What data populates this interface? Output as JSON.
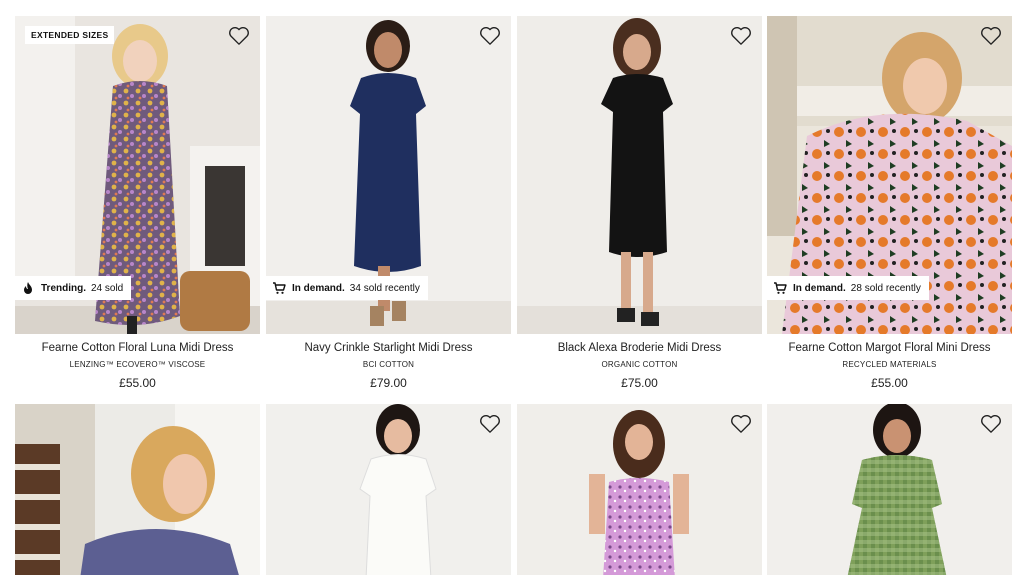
{
  "products": [
    {
      "name": "Fearne Cotton Floral Luna Midi Dress",
      "fabric": "LENZING™ ECOVERO™ VISCOSE",
      "price": "£55.00",
      "top_tag": "EXTENDED SIZES",
      "badge": {
        "icon": "flame-icon",
        "strong": "Trending.",
        "text": "24 sold"
      }
    },
    {
      "name": "Navy Crinkle Starlight Midi Dress",
      "fabric": "BCI COTTON",
      "price": "£79.00",
      "badge": {
        "icon": "cart-icon",
        "strong": "In demand.",
        "text": "34 sold recently"
      }
    },
    {
      "name": "Black Alexa Broderie Midi Dress",
      "fabric": "ORGANIC COTTON",
      "price": "£75.00"
    },
    {
      "name": "Fearne Cotton Margot Floral Mini Dress",
      "fabric": "RECYCLED MATERIALS",
      "price": "£55.00",
      "badge": {
        "icon": "cart-icon",
        "strong": "In demand.",
        "text": "28 sold recently"
      }
    },
    {
      "name": "",
      "fabric": "",
      "price": ""
    },
    {
      "name": "",
      "fabric": "",
      "price": ""
    },
    {
      "name": "",
      "fabric": "",
      "price": ""
    },
    {
      "name": "",
      "fabric": "",
      "price": ""
    }
  ],
  "icons": {
    "wishlist": "heart-icon",
    "trending": "flame-icon",
    "demand": "cart-icon"
  },
  "colors": {
    "background": "#ffffff",
    "text": "#222222",
    "badge_bg": "#ffffff"
  }
}
